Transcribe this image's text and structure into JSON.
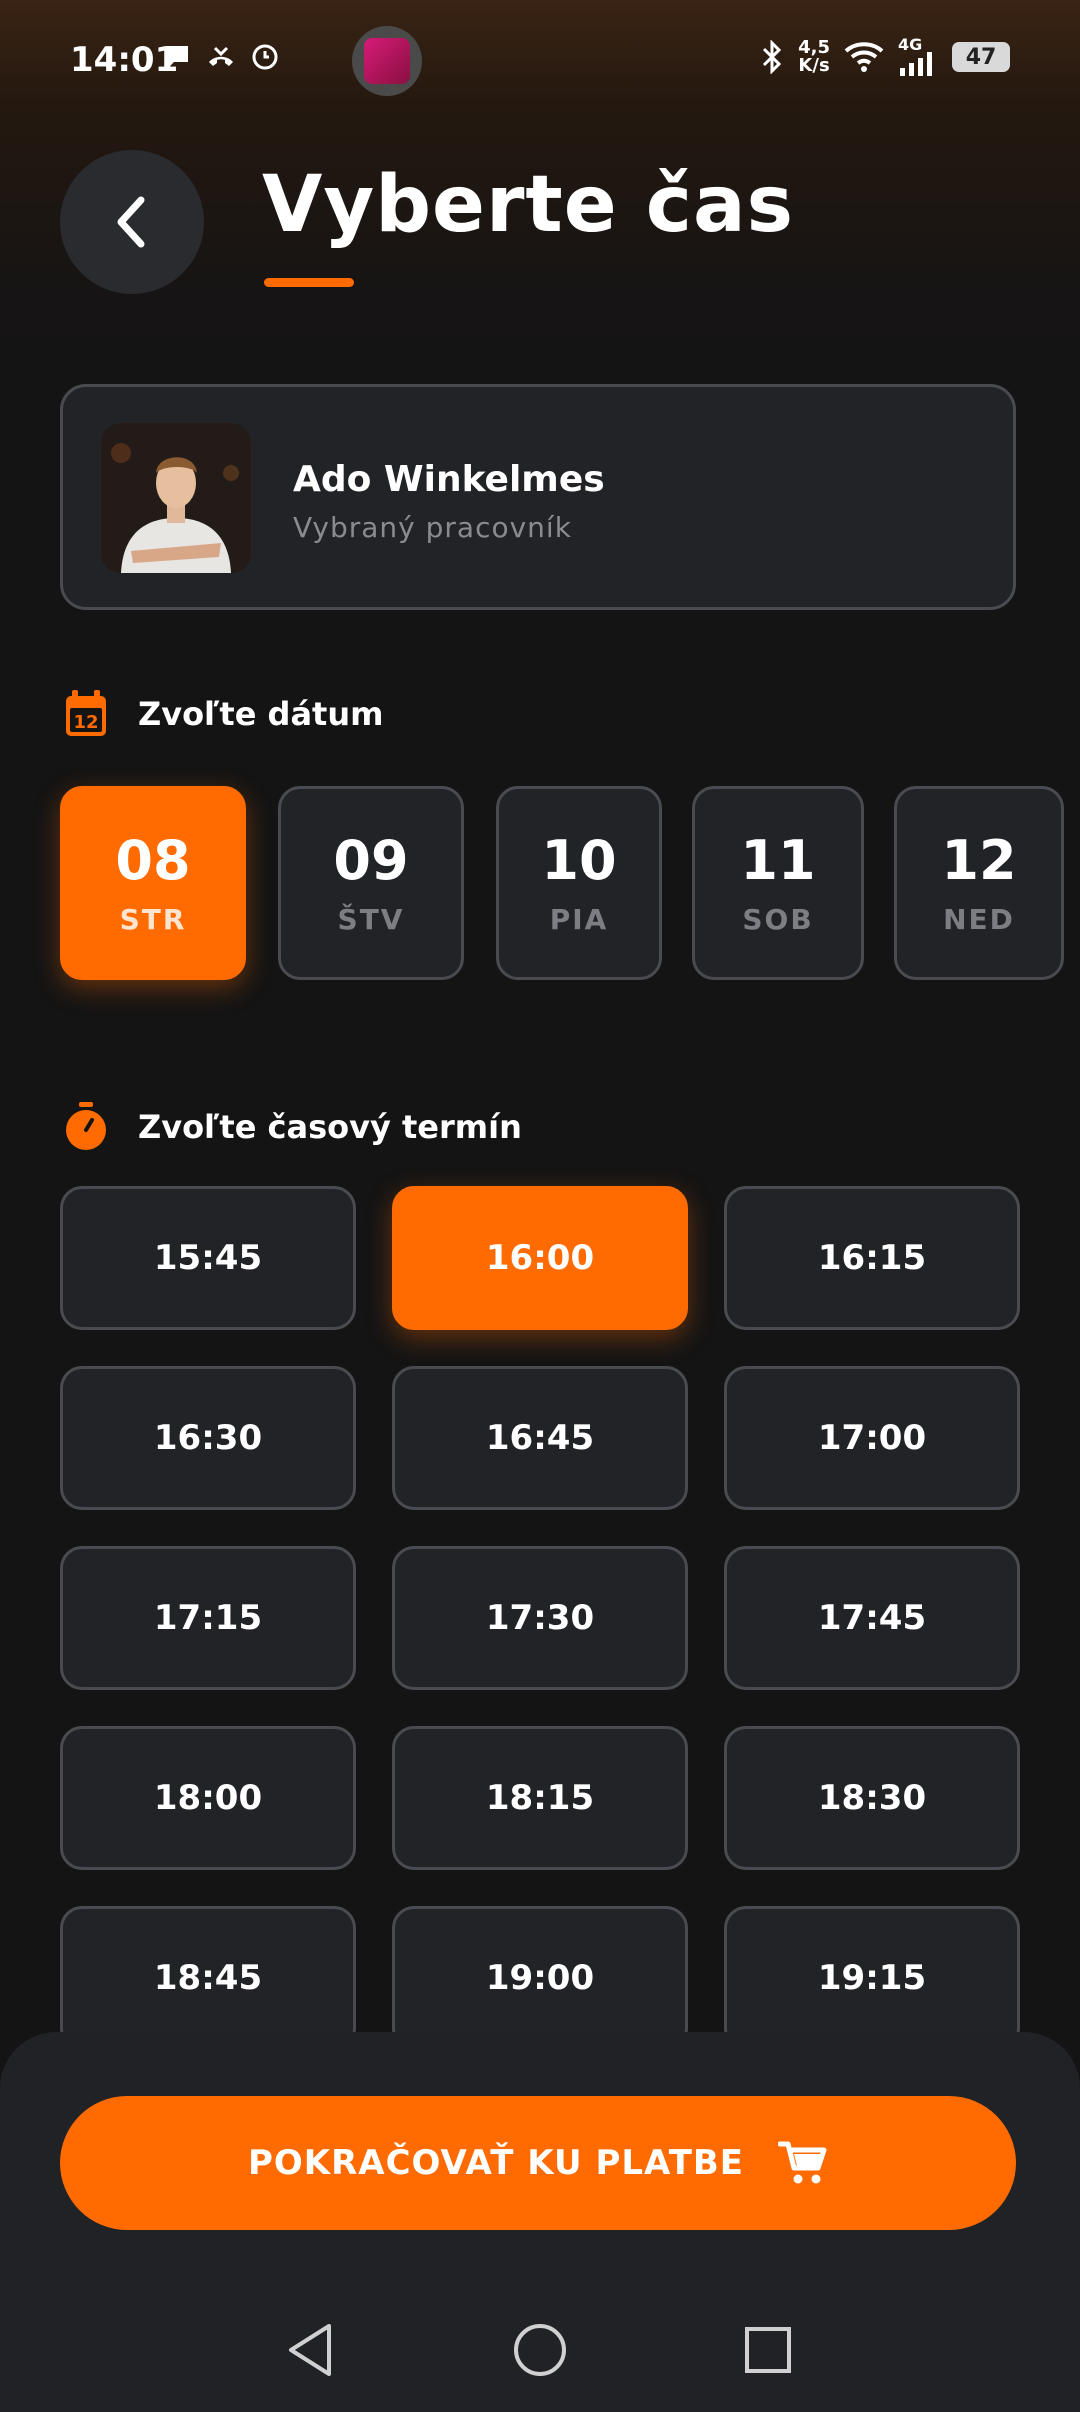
{
  "status_bar": {
    "time": "14:01",
    "net_speed_value": "4,5",
    "net_speed_unit": "K/s",
    "network_type": "4G",
    "battery": "47"
  },
  "header": {
    "title": "Vyberte čas"
  },
  "worker": {
    "name": "Ado Winkelmes",
    "role": "Vybraný pracovník"
  },
  "date_section": {
    "label": "Zvoľte dátum",
    "calendar_icon_day": "12",
    "dates": [
      {
        "num": "08",
        "day": "STR",
        "selected": true
      },
      {
        "num": "09",
        "day": "ŠTV",
        "selected": false
      },
      {
        "num": "10",
        "day": "PIA",
        "selected": false
      },
      {
        "num": "11",
        "day": "SOB",
        "selected": false
      },
      {
        "num": "12",
        "day": "NED",
        "selected": false
      }
    ]
  },
  "time_section": {
    "label": "Zvoľte časový termín",
    "slots": [
      "15:45",
      "16:00",
      "16:15",
      "16:30",
      "16:45",
      "17:00",
      "17:15",
      "17:30",
      "17:45",
      "18:00",
      "18:15",
      "18:30",
      "18:45",
      "19:00",
      "19:15"
    ],
    "selected_slot": "16:00"
  },
  "cta": {
    "label": "POKRAČOVAŤ KU PLATBE"
  },
  "colors": {
    "accent": "#ff6b00",
    "card_bg": "#222327",
    "card_border": "#4a4b50",
    "background": "#141414"
  },
  "icons": {
    "back": "chevron-left-icon",
    "calendar": "calendar-icon",
    "timer": "stopwatch-icon",
    "cart": "cart-icon"
  }
}
